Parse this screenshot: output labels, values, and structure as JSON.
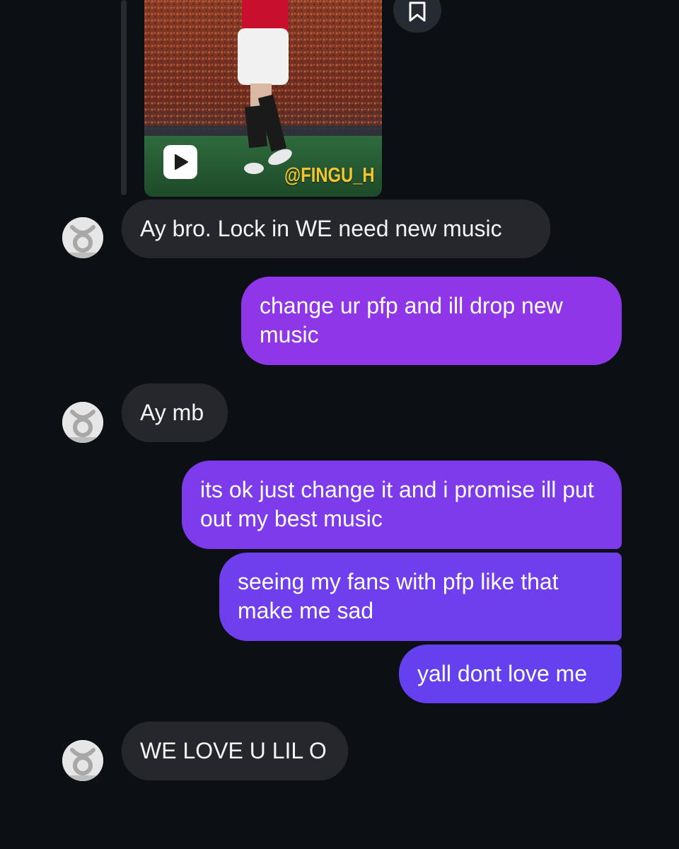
{
  "shared_post": {
    "watermark": "@FINGU_H",
    "play_icon": "play-icon",
    "save_icon": "bookmark-icon"
  },
  "messages": [
    {
      "direction": "incoming",
      "text": "Ay bro. Lock in WE need new music"
    },
    {
      "direction": "outgoing",
      "text": "change ur pfp and ill drop new music"
    },
    {
      "direction": "incoming",
      "text": "Ay mb"
    },
    {
      "direction": "outgoing",
      "text": "its ok just change it and i promise ill put out my best music"
    },
    {
      "direction": "outgoing",
      "text": "seeing my fans with pfp like that make me sad"
    },
    {
      "direction": "outgoing",
      "text": "yall dont love me"
    },
    {
      "direction": "incoming",
      "text": "WE LOVE U LIL O"
    }
  ],
  "avatar_icon": "taurus-symbol-icon",
  "colors": {
    "background": "#0c0f14",
    "incoming_bubble": "#25272c",
    "outgoing_gradient_top": "#9a35e8",
    "outgoing_gradient_bottom": "#6240ee"
  }
}
